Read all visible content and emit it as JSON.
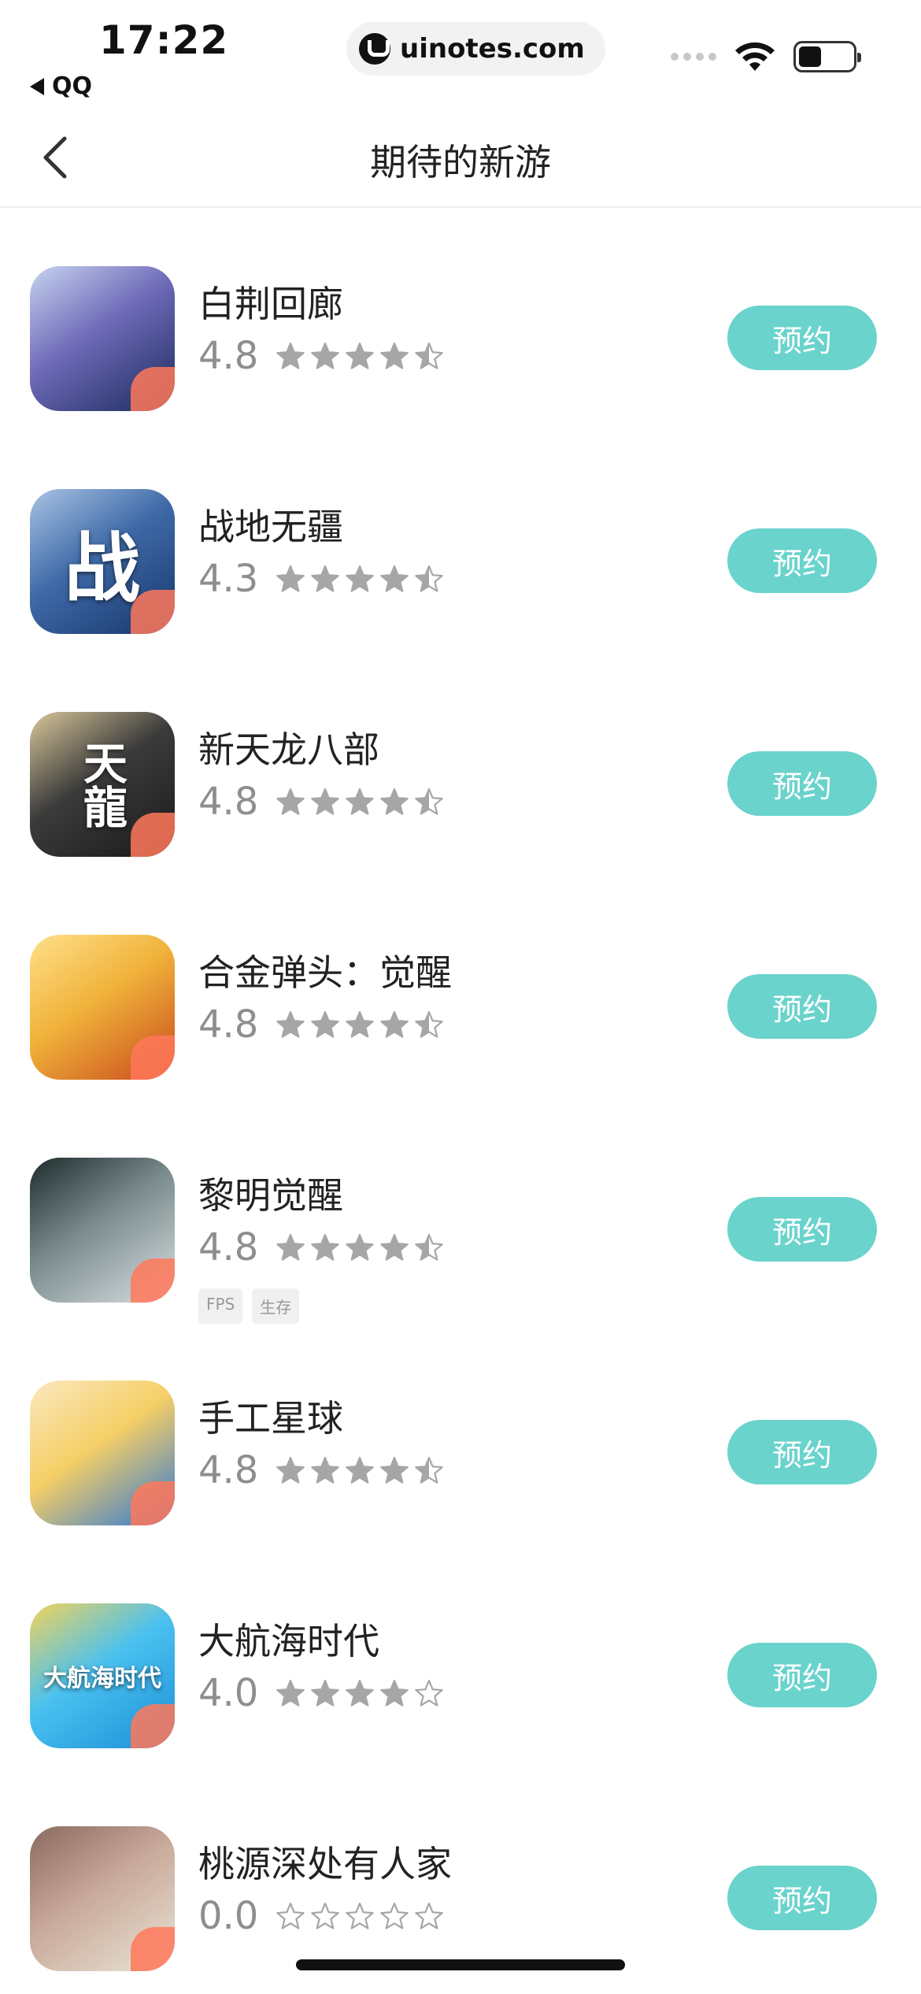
{
  "status": {
    "time": "17:22",
    "back_app": "QQ",
    "url": "uinotes.com"
  },
  "nav": {
    "title": "期待的新游"
  },
  "colors": {
    "accent": "#6ad3cc",
    "star": "#a6a6a6",
    "score": "#8e8e8e"
  },
  "games": [
    {
      "name": "白荆回廊",
      "score": "4.8",
      "stars": 4.5,
      "tags": [],
      "button": "预约",
      "icon_colors": [
        "#1b2a5c",
        "#6e6ab8",
        "#c7d3f0"
      ],
      "icon_glyph": ""
    },
    {
      "name": "战地无疆",
      "score": "4.3",
      "stars": 4.5,
      "tags": [],
      "button": "预约",
      "icon_colors": [
        "#17366b",
        "#3f6aa8",
        "#a9c4e4"
      ],
      "icon_glyph": "战"
    },
    {
      "name": "新天龙八部",
      "score": "4.8",
      "stars": 4.5,
      "tags": [],
      "button": "预约",
      "icon_colors": [
        "#1a1a1a",
        "#3b3b3b",
        "#d9c79a"
      ],
      "icon_glyph": "天龍"
    },
    {
      "name": "合金弹头：觉醒",
      "score": "4.8",
      "stars": 4.5,
      "tags": [],
      "button": "预约",
      "icon_colors": [
        "#c94a1c",
        "#f0b23a",
        "#ffe08a"
      ],
      "icon_glyph": ""
    },
    {
      "name": "黎明觉醒",
      "score": "4.8",
      "stars": 4.5,
      "tags": [
        "FPS",
        "生存"
      ],
      "button": "预约",
      "icon_colors": [
        "#d9e0e2",
        "#7b8c8e",
        "#1e2b2c"
      ],
      "icon_glyph": ""
    },
    {
      "name": "手工星球",
      "score": "4.8",
      "stars": 4.5,
      "tags": [],
      "button": "预约",
      "icon_colors": [
        "#2d76d8",
        "#f5cf66",
        "#fbe8c0"
      ],
      "icon_glyph": ""
    },
    {
      "name": "大航海时代",
      "score": "4.0",
      "stars": 4,
      "tags": [],
      "button": "预约",
      "icon_colors": [
        "#1d8fd6",
        "#4ac1f0",
        "#f3d35a"
      ],
      "icon_glyph": "大航海时代"
    },
    {
      "name": "桃源深处有人家",
      "score": "0.0",
      "stars": 0,
      "tags": [],
      "button": "预约",
      "icon_colors": [
        "#e9e5d6",
        "#c9a99a",
        "#8a6a5f"
      ],
      "icon_glyph": ""
    }
  ]
}
